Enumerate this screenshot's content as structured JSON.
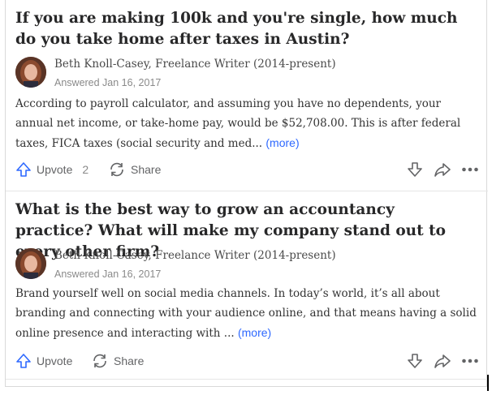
{
  "answers": [
    {
      "question": "If you are making 100k and you're single, how much do you take home after taxes in Austin?",
      "author": "Beth Knoll-Casey, Freelance Writer (2014-present)",
      "date": "Answered Jan 16, 2017",
      "excerpt": "According to payroll calculator, and assuming you have no dependents, your annual net income, or take-home pay, would be $52,708.00. This is after federal taxes, FICA taxes (social security and med...",
      "more": "(more)",
      "upvote_label": "Upvote",
      "upvote_count": "2",
      "share_label": "Share"
    },
    {
      "question": "What is the best way to grow an accountancy practice? What will make my company stand out to every other firm?",
      "author": "Beth Knoll-Casey, Freelance Writer (2014-present)",
      "date": "Answered Jan 16, 2017",
      "excerpt": "Brand yourself well on social media channels. In today’s world, it’s all about branding and connecting with your audience online, and that means having a solid online presence and interacting with ...",
      "more": "(more)",
      "upvote_label": "Upvote",
      "upvote_count": "",
      "share_label": "Share"
    }
  ],
  "colors": {
    "accent": "#2e69ff",
    "upvote_icon": "#2e69ff",
    "text": "#282829",
    "muted": "#636466"
  },
  "icons": [
    "avatar",
    "upvote-arrow-icon",
    "share-refresh-icon",
    "downvote-arrow-icon",
    "forward-share-icon",
    "more-options-icon"
  ]
}
